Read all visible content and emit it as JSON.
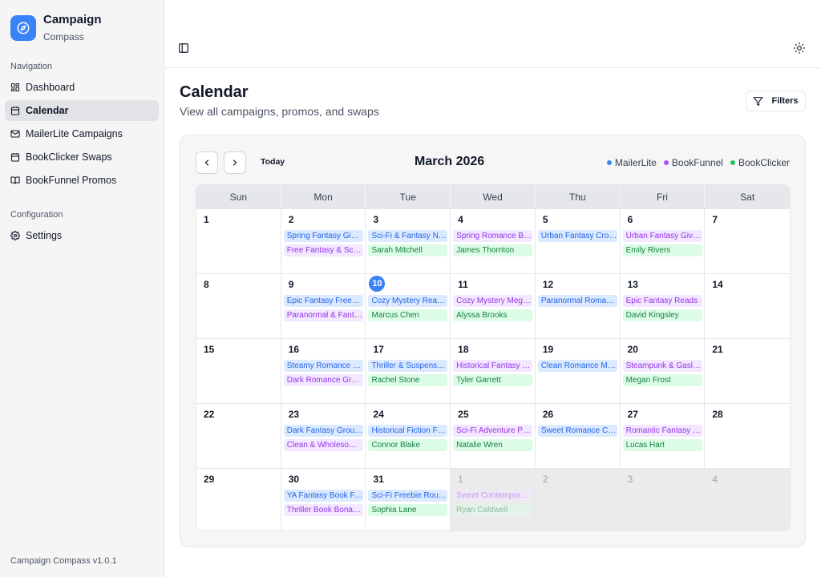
{
  "brand": {
    "title": "Campaign",
    "subtitle": "Compass"
  },
  "sidebar": {
    "nav_label": "Navigation",
    "items": [
      {
        "label": "Dashboard",
        "icon": "dashboard-icon",
        "active": false
      },
      {
        "label": "Calendar",
        "icon": "calendar-icon",
        "active": true
      },
      {
        "label": "MailerLite Campaigns",
        "icon": "mail-icon",
        "active": false
      },
      {
        "label": "BookClicker Swaps",
        "icon": "calendar-icon",
        "active": false
      },
      {
        "label": "BookFunnel Promos",
        "icon": "book-icon",
        "active": false
      }
    ],
    "config_label": "Configuration",
    "config_items": [
      {
        "label": "Settings",
        "icon": "gear-icon"
      }
    ],
    "version": "Campaign Compass v1.0.1"
  },
  "header": {
    "title": "Calendar",
    "subtitle": "View all campaigns, promos, and swaps",
    "filters_label": "Filters"
  },
  "calendar": {
    "month": "March 2026",
    "today_label": "Today",
    "legend": [
      {
        "label": "MailerLite",
        "color": "#3b82f6"
      },
      {
        "label": "BookFunnel",
        "color": "#a855f7"
      },
      {
        "label": "BookClicker",
        "color": "#22c55e"
      }
    ],
    "days_of_week": [
      "Sun",
      "Mon",
      "Tue",
      "Wed",
      "Thu",
      "Fri",
      "Sat"
    ],
    "weeks": [
      [
        {
          "day": "1",
          "events": []
        },
        {
          "day": "2",
          "events": [
            {
              "type": "mailerlite",
              "label": "Spring Fantasy Giveaway"
            },
            {
              "type": "bookfunnel",
              "label": "Free Fantasy & Sci-Fi Reads"
            }
          ]
        },
        {
          "day": "3",
          "events": [
            {
              "type": "mailerlite",
              "label": "Sci-Fi & Fantasy Newsletter"
            },
            {
              "type": "bookclicker",
              "label": "Sarah Mitchell"
            }
          ]
        },
        {
          "day": "4",
          "events": [
            {
              "type": "bookfunnel",
              "label": "Spring Romance Bundle"
            },
            {
              "type": "bookclicker",
              "label": "James Thornton"
            }
          ]
        },
        {
          "day": "5",
          "events": [
            {
              "type": "mailerlite",
              "label": "Urban Fantasy Crossover"
            }
          ]
        },
        {
          "day": "6",
          "events": [
            {
              "type": "bookfunnel",
              "label": "Urban Fantasy Giveaway"
            },
            {
              "type": "bookclicker",
              "label": "Emily Rivers"
            }
          ]
        },
        {
          "day": "7",
          "events": []
        }
      ],
      [
        {
          "day": "8",
          "events": []
        },
        {
          "day": "9",
          "events": [
            {
              "type": "mailerlite",
              "label": "Epic Fantasy Freebies"
            },
            {
              "type": "bookfunnel",
              "label": "Paranormal & Fantasy Promo"
            }
          ]
        },
        {
          "day": "10",
          "today": true,
          "events": [
            {
              "type": "mailerlite",
              "label": "Cozy Mystery Readers"
            },
            {
              "type": "bookclicker",
              "label": "Marcus Chen"
            }
          ]
        },
        {
          "day": "11",
          "events": [
            {
              "type": "bookfunnel",
              "label": "Cozy Mystery Mega Promo"
            },
            {
              "type": "bookclicker",
              "label": "Alyssa Brooks"
            }
          ]
        },
        {
          "day": "12",
          "events": [
            {
              "type": "mailerlite",
              "label": "Paranormal Romance News"
            }
          ]
        },
        {
          "day": "13",
          "events": [
            {
              "type": "bookfunnel",
              "label": "Epic Fantasy Reads"
            },
            {
              "type": "bookclicker",
              "label": "David Kingsley"
            }
          ]
        },
        {
          "day": "14",
          "events": []
        }
      ],
      [
        {
          "day": "15",
          "events": []
        },
        {
          "day": "16",
          "events": [
            {
              "type": "mailerlite",
              "label": "Steamy Romance Roundup"
            },
            {
              "type": "bookfunnel",
              "label": "Dark Romance Group Promo"
            }
          ]
        },
        {
          "day": "17",
          "events": [
            {
              "type": "mailerlite",
              "label": "Thriller & Suspense Picks"
            },
            {
              "type": "bookclicker",
              "label": "Rachel Stone"
            }
          ]
        },
        {
          "day": "18",
          "events": [
            {
              "type": "bookfunnel",
              "label": "Historical Fantasy Promo"
            },
            {
              "type": "bookclicker",
              "label": "Tyler Garrett"
            }
          ]
        },
        {
          "day": "19",
          "events": [
            {
              "type": "mailerlite",
              "label": "Clean Romance Monthly"
            }
          ]
        },
        {
          "day": "20",
          "events": [
            {
              "type": "bookfunnel",
              "label": "Steampunk & Gaslamp Reads"
            },
            {
              "type": "bookclicker",
              "label": "Megan Frost"
            }
          ]
        },
        {
          "day": "21",
          "events": []
        }
      ],
      [
        {
          "day": "22",
          "events": []
        },
        {
          "day": "23",
          "events": [
            {
              "type": "mailerlite",
              "label": "Dark Fantasy Group Promo"
            },
            {
              "type": "bookfunnel",
              "label": "Clean & Wholesome Reads"
            }
          ]
        },
        {
          "day": "24",
          "events": [
            {
              "type": "mailerlite",
              "label": "Historical Fiction Feature"
            },
            {
              "type": "bookclicker",
              "label": "Connor Blake"
            }
          ]
        },
        {
          "day": "25",
          "events": [
            {
              "type": "bookfunnel",
              "label": "Sci-Fi Adventure Promo"
            },
            {
              "type": "bookclicker",
              "label": "Natalie Wren"
            }
          ]
        },
        {
          "day": "26",
          "events": [
            {
              "type": "mailerlite",
              "label": "Sweet Romance Collection"
            }
          ]
        },
        {
          "day": "27",
          "events": [
            {
              "type": "bookfunnel",
              "label": "Romantic Fantasy Reads"
            },
            {
              "type": "bookclicker",
              "label": "Lucas Hart"
            }
          ]
        },
        {
          "day": "28",
          "events": []
        }
      ],
      [
        {
          "day": "29",
          "events": []
        },
        {
          "day": "30",
          "events": [
            {
              "type": "mailerlite",
              "label": "YA Fantasy Book Feature"
            },
            {
              "type": "bookfunnel",
              "label": "Thriller Book Bonanza"
            }
          ]
        },
        {
          "day": "31",
          "events": [
            {
              "type": "mailerlite",
              "label": "Sci-Fi Freebie Roundup"
            },
            {
              "type": "bookclicker",
              "label": "Sophia Lane"
            }
          ]
        },
        {
          "day": "1",
          "outside": true,
          "events": [
            {
              "type": "bookfunnel",
              "label": "Sweet Contemporary Romance"
            },
            {
              "type": "bookclicker",
              "label": "Ryan Caldwell"
            }
          ]
        },
        {
          "day": "2",
          "outside": true,
          "events": []
        },
        {
          "day": "3",
          "outside": true,
          "events": []
        },
        {
          "day": "4",
          "outside": true,
          "events": []
        }
      ]
    ]
  }
}
